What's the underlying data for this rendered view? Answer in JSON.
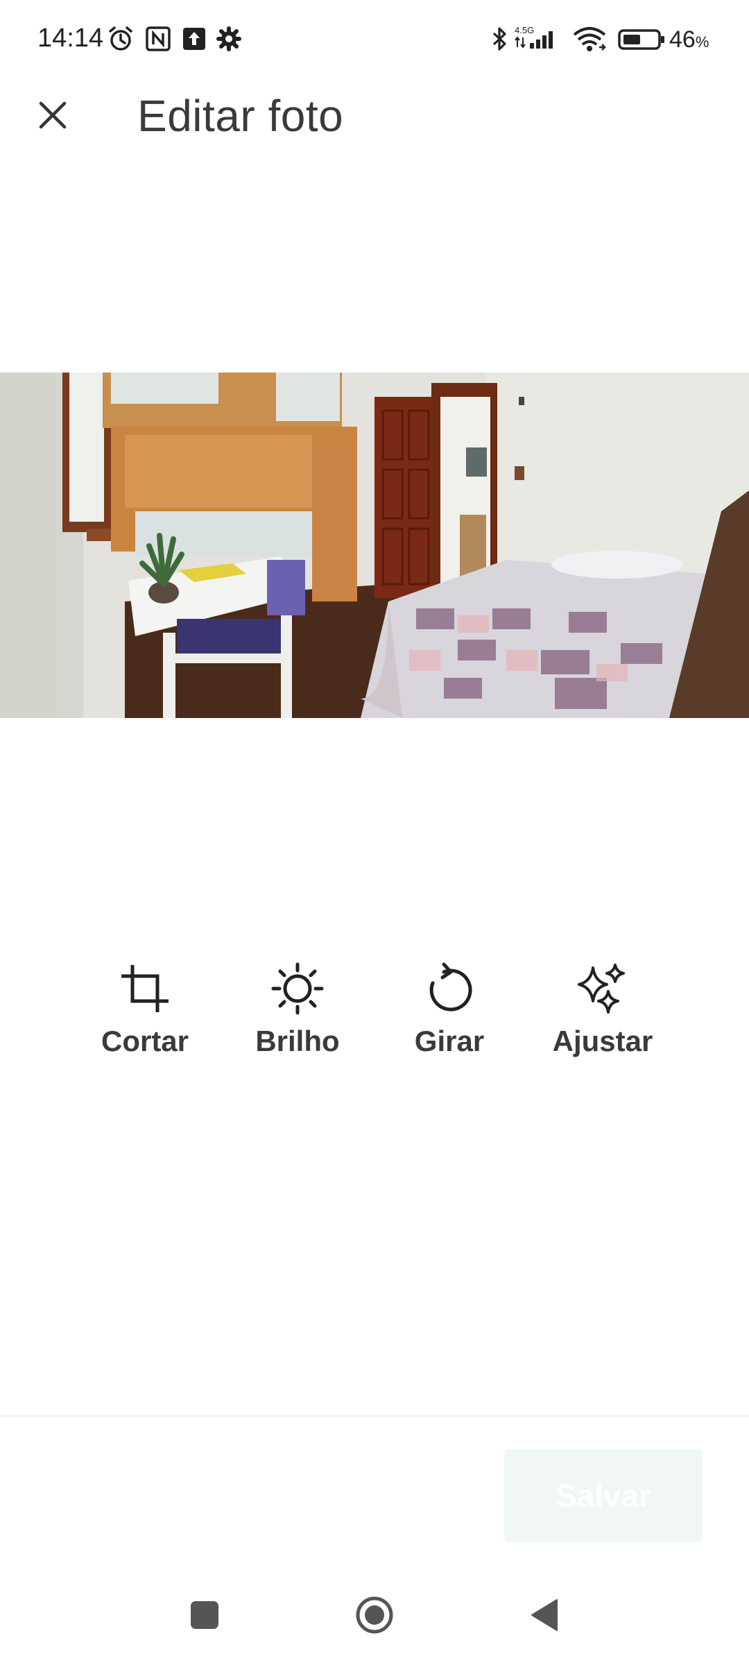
{
  "status_bar": {
    "time": "14:14",
    "network_label": "4.5G",
    "battery_percent": "46",
    "battery_unit": "%",
    "icons": [
      "alarm-icon",
      "nfc-icon",
      "upload-icon",
      "settings-icon",
      "bluetooth-icon",
      "signal-icon",
      "wifi-icon",
      "battery-icon"
    ]
  },
  "header": {
    "title": "Editar foto",
    "close_icon": "close-icon"
  },
  "tools": [
    {
      "label": "Cortar",
      "icon": "crop-icon"
    },
    {
      "label": "Brilho",
      "icon": "brightness-icon"
    },
    {
      "label": "Girar",
      "icon": "rotate-icon"
    },
    {
      "label": "Ajustar",
      "icon": "sparkle-icon"
    }
  ],
  "footer": {
    "save_label": "Salvar"
  },
  "colors": {
    "text": "#3a3a3a",
    "save_bg": "#f1f7f6",
    "save_text": "#ffffff"
  },
  "nav": [
    "recents-button",
    "home-button",
    "back-button"
  ]
}
